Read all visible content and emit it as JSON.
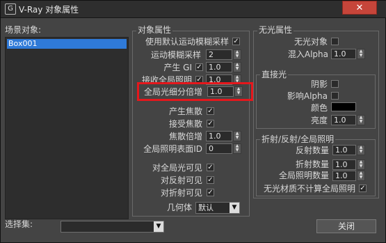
{
  "window": {
    "title": "V-Ray 对象属性",
    "close_symbol": "✕",
    "icon_glyph": "G"
  },
  "left": {
    "scene_objects_label": "场景对象:",
    "objects": [
      "Box001"
    ],
    "selection_set_label": "选择集:",
    "selection_set_value": ""
  },
  "object_props": {
    "group_label": "对象属性",
    "use_default_mb": {
      "label": "使用默认运动模糊采样",
      "checked": true
    },
    "mb_samples": {
      "label": "运动模糊采样",
      "value": "2"
    },
    "generate_gi": {
      "label": "产生 GI",
      "checked": true,
      "value": "1.0"
    },
    "receive_gi": {
      "label": "接收全局照明",
      "checked": true,
      "value": "1.0"
    },
    "gi_subdivs_mult": {
      "label": "全局光细分倍增",
      "value": "1.0"
    },
    "generate_caustics": {
      "label": "产生焦散",
      "checked": true
    },
    "receive_caustics": {
      "label": "接受焦散",
      "checked": true
    },
    "caustics_mult": {
      "label": "焦散倍增",
      "value": "1.0"
    },
    "gi_surface_id": {
      "label": "全局照明表面ID",
      "value": "0"
    },
    "visible_to_gi": {
      "label": "对全局光可见",
      "checked": true
    },
    "visible_to_reflections": {
      "label": "对反射可见",
      "checked": true
    },
    "visible_to_refractions": {
      "label": "对折射可见",
      "checked": true
    },
    "geometry": {
      "label": "几何体",
      "value": "默认",
      "drop_symbol": "▼"
    }
  },
  "matte": {
    "group_label": "无光属性",
    "matte_object": {
      "label": "无光对象",
      "checked": false
    },
    "alpha_contribution": {
      "label": "混入Alpha",
      "value": "1.0"
    },
    "direct_light": {
      "group_label": "直接光",
      "shadows": {
        "label": "阴影",
        "checked": false
      },
      "affect_alpha": {
        "label": "影响Alpha",
        "checked": false
      },
      "color": {
        "label": "颜色",
        "value": "#000000"
      },
      "brightness": {
        "label": "亮度",
        "value": "1.0"
      }
    },
    "rr_gi": {
      "group_label": "折射/反射/全局照明",
      "refraction_amount": {
        "label": "反射数量",
        "value": "1.0"
      },
      "reflection_amount": {
        "label": "折射数量",
        "value": "1.0"
      },
      "gi_amount": {
        "label": "全局照明数量",
        "value": "1.0"
      },
      "no_gi_on_other": {
        "label": "无光材质不计算全局照明",
        "checked": true
      }
    }
  },
  "buttons": {
    "close": "关闭"
  },
  "highlight_color": "#e5171c"
}
